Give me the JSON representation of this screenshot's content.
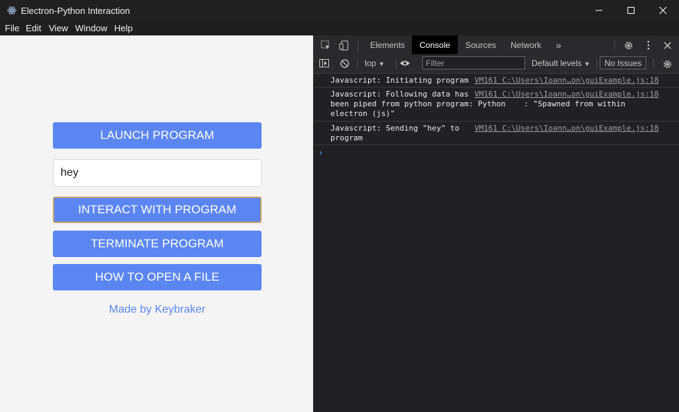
{
  "window": {
    "title": "Electron-Python Interaction"
  },
  "menu": [
    "File",
    "Edit",
    "View",
    "Window",
    "Help"
  ],
  "app": {
    "launch_label": "LAUNCH PROGRAM",
    "input_value": "hey",
    "interact_label": "INTERACT WITH PROGRAM",
    "terminate_label": "TERMINATE PROGRAM",
    "howto_label": "HOW TO OPEN A FILE",
    "credit": "Made by Keybraker"
  },
  "devtools": {
    "tabs": [
      "Elements",
      "Console",
      "Sources",
      "Network"
    ],
    "active_tab": "Console",
    "more_tabs": "»",
    "context": "top",
    "filter_placeholder": "Filter",
    "levels": "Default levels",
    "issues": "No Issues",
    "messages": [
      {
        "text": "Javascript: Initiating program",
        "source": "VM161 C:\\Users\\Ioann…on\\guiExample.js:18"
      },
      {
        "text": "Javascript: Following data has\nbeen piped from python program: Python    : \"Spawned from within\nelectron (js)\"",
        "source": "VM161 C:\\Users\\Ioann…on\\guiExample.js:18"
      },
      {
        "text": "Javascript: Sending \"hey\" to\nprogram",
        "source": "VM161 C:\\Users\\Ioann…on\\guiExample.js:18"
      }
    ],
    "prompt": "›"
  },
  "colors": {
    "accent": "#5b86f2",
    "app_bg": "#f4f4f4",
    "devtools_bg": "#202124"
  }
}
